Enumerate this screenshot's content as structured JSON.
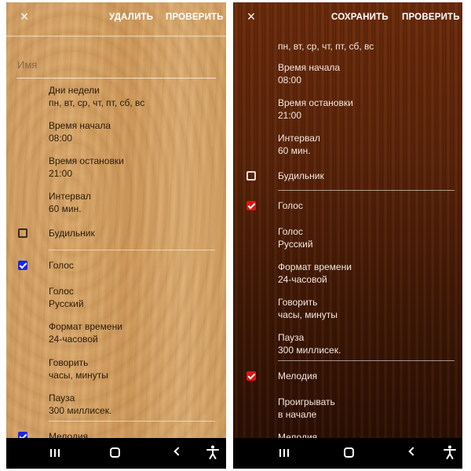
{
  "left": {
    "toolbar": {
      "close_icon": "×",
      "action1": "УДАЛИТЬ",
      "action2": "ПРОВЕРИТЬ"
    },
    "name_placeholder": "Имя",
    "settings": {
      "days": {
        "title": "Дни недели",
        "value": "пн, вт, ср, чт, пт, сб, вс"
      },
      "start": {
        "title": "Время начала",
        "value": "08:00"
      },
      "stop": {
        "title": "Время остановки",
        "value": "21:00"
      },
      "interval": {
        "title": "Интервал",
        "value": "60 мин."
      },
      "alarm": {
        "label": "Будильник",
        "checked": false
      },
      "voice_toggle": {
        "label": "Голос",
        "checked": true
      },
      "voice": {
        "title": "Голос",
        "value": "Русский"
      },
      "time_format": {
        "title": "Формат времени",
        "value": "24-часовой"
      },
      "speak": {
        "title": "Говорить",
        "value": "часы, минуты"
      },
      "pause": {
        "title": "Пауза",
        "value": "300 миллисек."
      },
      "melody_toggle": {
        "label": "Мелодия",
        "checked": true
      }
    },
    "colors": {
      "checkbox": "#1b24ea"
    }
  },
  "right": {
    "toolbar": {
      "close_icon": "×",
      "action1": "СОХРАНИТЬ",
      "action2": "ПРОВЕРИТЬ"
    },
    "settings": {
      "days_value": "пн, вт, ср, чт, пт, сб, вс",
      "start": {
        "title": "Время начала",
        "value": "08:00"
      },
      "stop": {
        "title": "Время остановки",
        "value": "21:00"
      },
      "interval": {
        "title": "Интервал",
        "value": "60 мин."
      },
      "alarm": {
        "label": "Будильник",
        "checked": false
      },
      "voice_toggle": {
        "label": "Голос",
        "checked": true
      },
      "voice": {
        "title": "Голос",
        "value": "Русский"
      },
      "time_format": {
        "title": "Формат времени",
        "value": "24-часовой"
      },
      "speak": {
        "title": "Говорить",
        "value": "часы, минуты"
      },
      "pause": {
        "title": "Пауза",
        "value": "300 миллисек."
      },
      "melody_toggle": {
        "label": "Мелодия",
        "checked": true
      },
      "play": {
        "title": "Проигрывать",
        "value": "в начале"
      },
      "melody_title": "Мелодия"
    },
    "colors": {
      "checkbox": "#e31212"
    }
  },
  "navbar": {
    "icons": [
      "recents-icon",
      "home-icon",
      "back-icon",
      "accessibility-icon"
    ]
  }
}
